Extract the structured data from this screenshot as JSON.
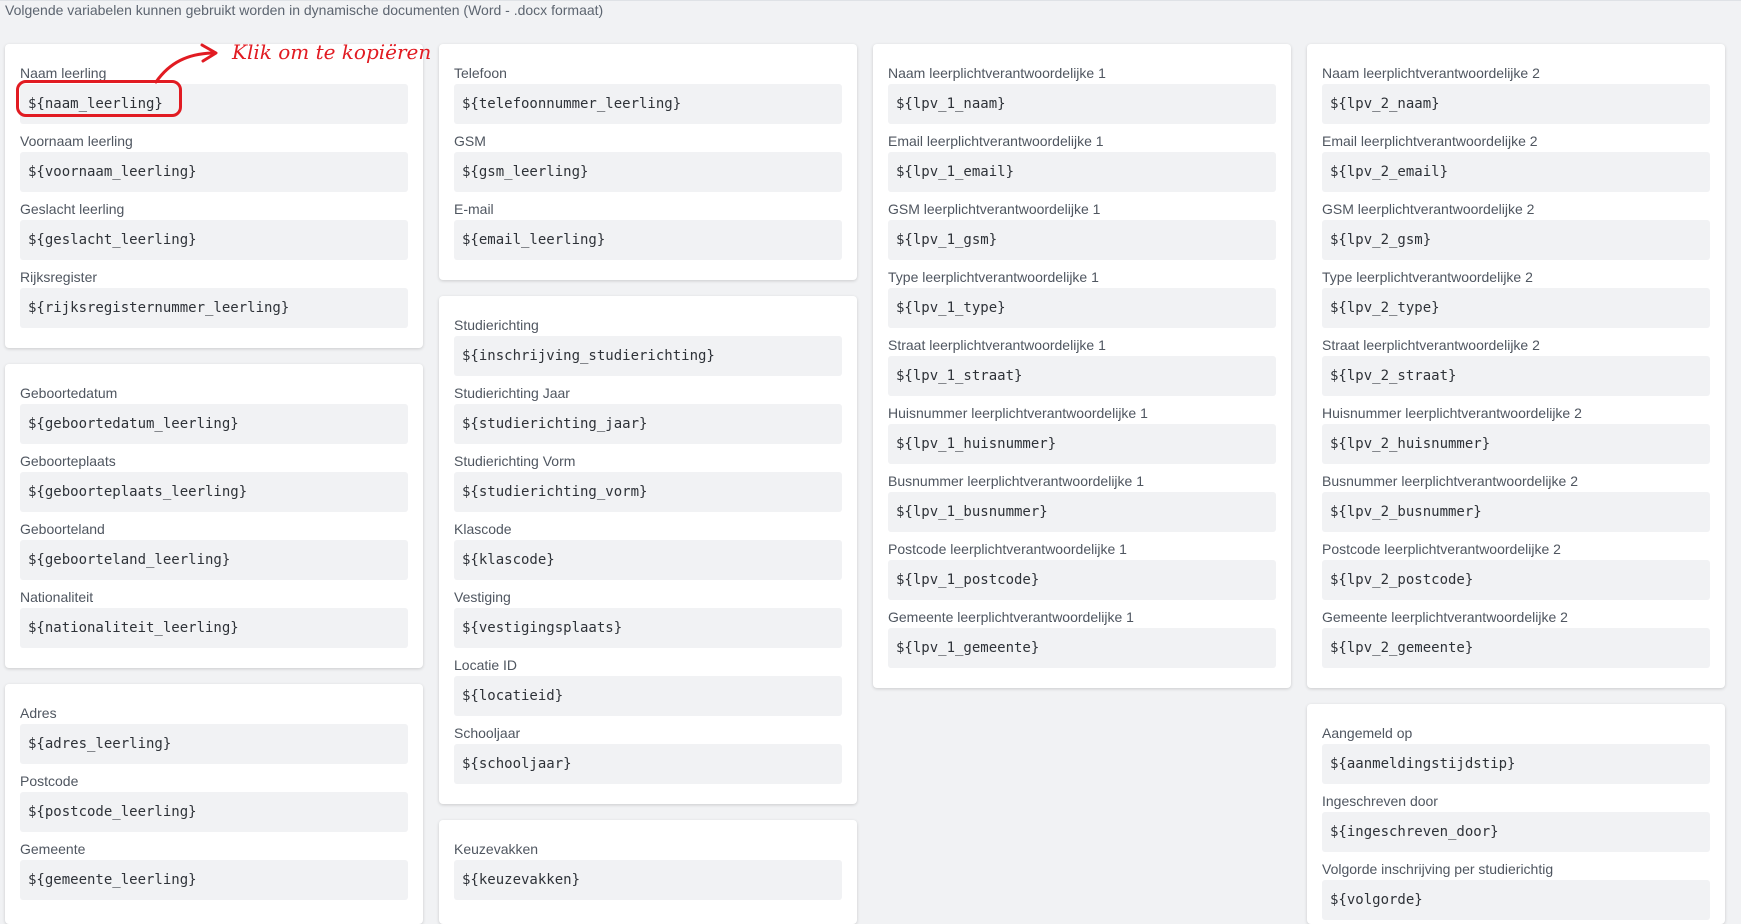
{
  "intro": "Volgende variabelen kunnen gebruikt worden in dynamische documenten (Word - .docx formaat)",
  "annotation": {
    "text": "Klik om te kopiëren",
    "color": "#e11b22"
  },
  "cards": {
    "c1": [
      {
        "label": "Naam leerling",
        "code": "${naam_leerling}"
      },
      {
        "label": "Voornaam leerling",
        "code": "${voornaam_leerling}"
      },
      {
        "label": "Geslacht leerling",
        "code": "${geslacht_leerling}"
      },
      {
        "label": "Rijksregister",
        "code": "${rijksregisternummer_leerling}"
      }
    ],
    "c2": [
      {
        "label": "Geboortedatum",
        "code": "${geboortedatum_leerling}"
      },
      {
        "label": "Geboorteplaats",
        "code": "${geboorteplaats_leerling}"
      },
      {
        "label": "Geboorteland",
        "code": "${geboorteland_leerling}"
      },
      {
        "label": "Nationaliteit",
        "code": "${nationaliteit_leerling}"
      }
    ],
    "c3": [
      {
        "label": "Adres",
        "code": "${adres_leerling}"
      },
      {
        "label": "Postcode",
        "code": "${postcode_leerling}"
      },
      {
        "label": "Gemeente",
        "code": "${gemeente_leerling}"
      }
    ],
    "c4": [
      {
        "label": "Telefoon",
        "code": "${telefoonnummer_leerling}"
      },
      {
        "label": "GSM",
        "code": "${gsm_leerling}"
      },
      {
        "label": "E-mail",
        "code": "${email_leerling}"
      }
    ],
    "c5": [
      {
        "label": "Studierichting",
        "code": "${inschrijving_studierichting}"
      },
      {
        "label": "Studierichting Jaar",
        "code": "${studierichting_jaar}"
      },
      {
        "label": "Studierichting Vorm",
        "code": "${studierichting_vorm}"
      },
      {
        "label": "Klascode",
        "code": "${klascode}"
      },
      {
        "label": "Vestiging",
        "code": "${vestigingsplaats}"
      },
      {
        "label": "Locatie ID",
        "code": "${locatieid}"
      },
      {
        "label": "Schooljaar",
        "code": "${schooljaar}"
      }
    ],
    "c6": [
      {
        "label": "Keuzevakken",
        "code": "${keuzevakken}"
      }
    ],
    "c7": [
      {
        "label": "Naam leerplichtverantwoordelijke 1",
        "code": "${lpv_1_naam}"
      },
      {
        "label": "Email leerplichtverantwoordelijke 1",
        "code": "${lpv_1_email}"
      },
      {
        "label": "GSM leerplichtverantwoordelijke 1",
        "code": "${lpv_1_gsm}"
      },
      {
        "label": "Type leerplichtverantwoordelijke 1",
        "code": "${lpv_1_type}"
      },
      {
        "label": "Straat leerplichtverantwoordelijke 1",
        "code": "${lpv_1_straat}"
      },
      {
        "label": "Huisnummer leerplichtverantwoordelijke 1",
        "code": "${lpv_1_huisnummer}"
      },
      {
        "label": "Busnummer leerplichtverantwoordelijke 1",
        "code": "${lpv_1_busnummer}"
      },
      {
        "label": "Postcode leerplichtverantwoordelijke 1",
        "code": "${lpv_1_postcode}"
      },
      {
        "label": "Gemeente leerplichtverantwoordelijke 1",
        "code": "${lpv_1_gemeente}"
      }
    ],
    "c8": [
      {
        "label": "Naam leerplichtverantwoordelijke 2",
        "code": "${lpv_2_naam}"
      },
      {
        "label": "Email leerplichtverantwoordelijke 2",
        "code": "${lpv_2_email}"
      },
      {
        "label": "GSM leerplichtverantwoordelijke 2",
        "code": "${lpv_2_gsm}"
      },
      {
        "label": "Type leerplichtverantwoordelijke 2",
        "code": "${lpv_2_type}"
      },
      {
        "label": "Straat leerplichtverantwoordelijke 2",
        "code": "${lpv_2_straat}"
      },
      {
        "label": "Huisnummer leerplichtverantwoordelijke 2",
        "code": "${lpv_2_huisnummer}"
      },
      {
        "label": "Busnummer leerplichtverantwoordelijke 2",
        "code": "${lpv_2_busnummer}"
      },
      {
        "label": "Postcode leerplichtverantwoordelijke 2",
        "code": "${lpv_2_postcode}"
      },
      {
        "label": "Gemeente leerplichtverantwoordelijke 2",
        "code": "${lpv_2_gemeente}"
      }
    ],
    "c9": [
      {
        "label": "Aangemeld op",
        "code": "${aanmeldingstijdstip}"
      },
      {
        "label": "Ingeschreven door",
        "code": "${ingeschreven_door}"
      },
      {
        "label": "Volgorde inschrijving per studierichtig",
        "code": "${volgorde}"
      }
    ]
  }
}
